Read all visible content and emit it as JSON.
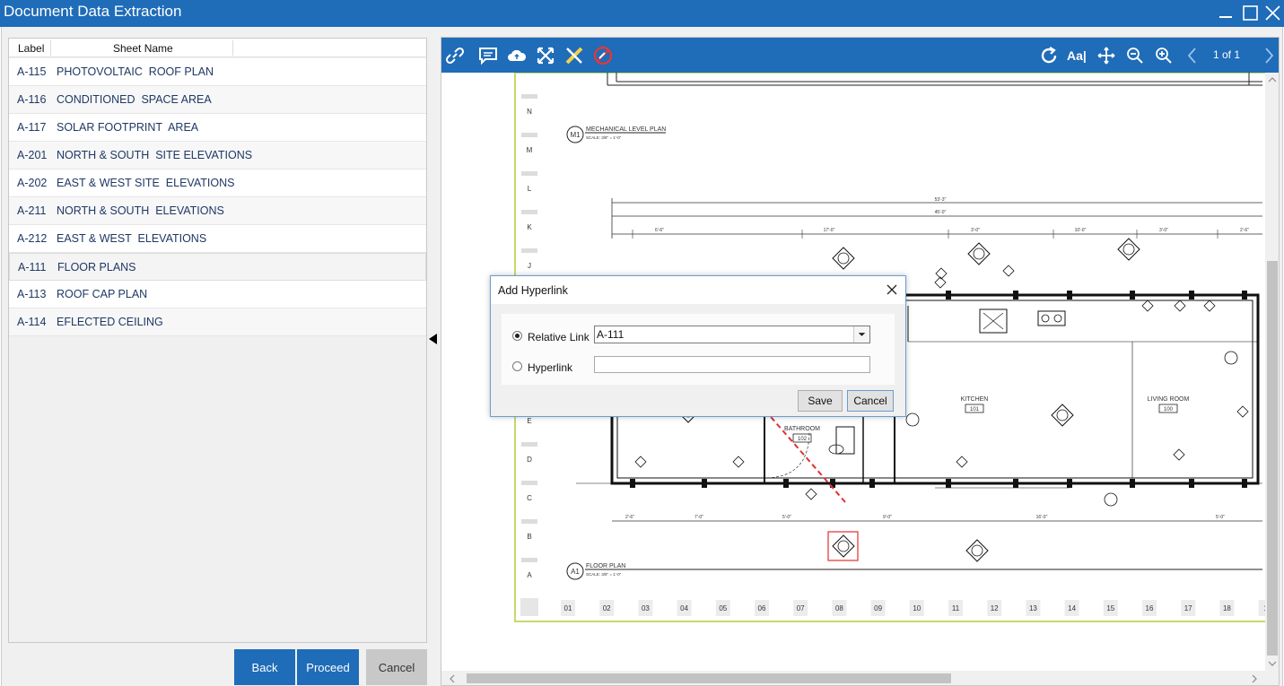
{
  "window": {
    "title": "Document Data Extraction"
  },
  "sheet_table": {
    "headers": {
      "label": "Label",
      "sheet_name": "Sheet Name"
    },
    "rows": [
      {
        "label": "A-115",
        "name": "PHOTOVOLTAIC  ROOF PLAN"
      },
      {
        "label": "A-116",
        "name": "CONDITIONED  SPACE AREA"
      },
      {
        "label": "A-117",
        "name": "SOLAR FOOTPRINT  AREA"
      },
      {
        "label": "A-201",
        "name": "NORTH & SOUTH  SITE ELEVATIONS"
      },
      {
        "label": "A-202",
        "name": "EAST & WEST SITE  ELEVATIONS"
      },
      {
        "label": "A-211",
        "name": "NORTH & SOUTH  ELEVATIONS"
      },
      {
        "label": "A-212",
        "name": "EAST & WEST  ELEVATIONS"
      },
      {
        "label": "A-111",
        "name": "FLOOR PLANS"
      },
      {
        "label": "A-113",
        "name": "ROOF CAP PLAN"
      },
      {
        "label": "A-114",
        "name": "EFLECTED CEILING"
      }
    ],
    "selected_index": 7
  },
  "footer_buttons": {
    "back": "Back",
    "proceed": "Proceed",
    "cancel": "Cancel"
  },
  "viewer": {
    "toolbar_left_icons": [
      "link-icon",
      "comment-icon",
      "cloud-icon",
      "fit-arrows-icon",
      "measure-icon",
      "no-edit-icon"
    ],
    "toolbar_right_icons": [
      "rotate-icon",
      "text-size-icon",
      "pan-icon",
      "zoom-out-icon",
      "zoom-in-icon",
      "prev-page-icon",
      "next-page-icon"
    ],
    "text_size_label": "Aa|",
    "page_indicator": "1 of 1",
    "drawing": {
      "row_labels": [
        "N",
        "M",
        "L",
        "K",
        "J",
        "E",
        "D",
        "C",
        "B",
        "A"
      ],
      "column_labels": [
        "01",
        "02",
        "03",
        "04",
        "05",
        "06",
        "07",
        "08",
        "09",
        "10",
        "11",
        "12",
        "13",
        "14",
        "15",
        "16",
        "17",
        "18",
        "1"
      ],
      "mechanical_tag": "M1",
      "mechanical_title": "MECHANICAL LEVEL PLAN",
      "mechanical_scale": "SCALE: 3/8\" = 1'-0\"",
      "floor_tag": "A1",
      "floor_title": "FLOOR PLAN",
      "floor_scale": "SCALE: 3/8\" = 1'-0\"",
      "overall_dim": "53'-3\"",
      "second_dim": "45'-0\"",
      "top_dims": [
        "6'-6\"",
        "17'-0\"",
        "3'-0\"",
        "10'-0\"",
        "3'-0\"",
        "2'-6\""
      ],
      "bottom_dims": [
        "2'-6\"",
        "7'-0\"",
        "5'-0\"",
        "9'-0\"",
        "16'-0\"",
        "5'-0\""
      ],
      "rooms": [
        {
          "name": "KITCHEN",
          "number": "101"
        },
        {
          "name": "LIVING ROOM",
          "number": "100"
        },
        {
          "name": "BATHROOM",
          "number": "102"
        }
      ]
    }
  },
  "dialog": {
    "title": "Add Hyperlink",
    "relative_link_label": "Relative Link",
    "relative_link_value": "A-111",
    "hyperlink_label": "Hyperlink",
    "hyperlink_value": "",
    "save": "Save",
    "cancel": "Cancel"
  },
  "colors": {
    "accent": "#1f6cb8",
    "annotation": "#e03030",
    "sheet_border": "#c5da6a"
  }
}
